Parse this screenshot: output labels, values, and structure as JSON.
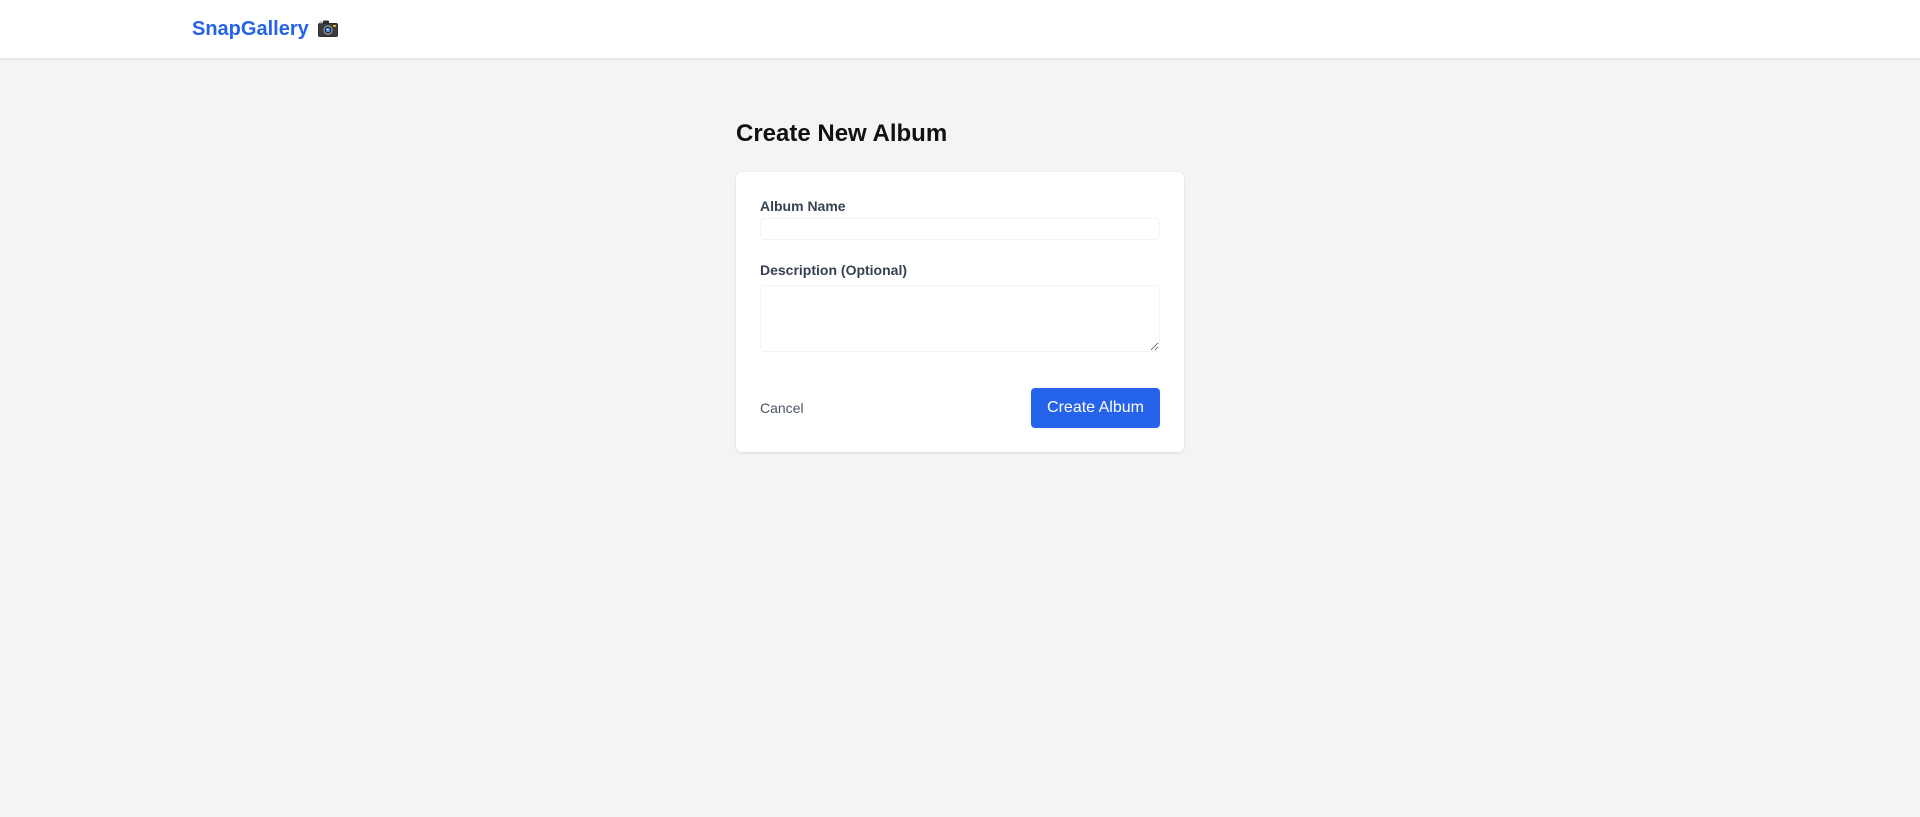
{
  "header": {
    "brand": "SnapGallery",
    "brand_icon": "camera-icon",
    "brand_color": "#2563eb"
  },
  "main": {
    "title": "Create New Album"
  },
  "form": {
    "album_name": {
      "label": "Album Name",
      "value": "",
      "placeholder": ""
    },
    "description": {
      "label": "Description (Optional)",
      "value": "",
      "placeholder": ""
    },
    "cancel_label": "Cancel",
    "submit_label": "Create Album",
    "submit_color": "#2563eb"
  }
}
